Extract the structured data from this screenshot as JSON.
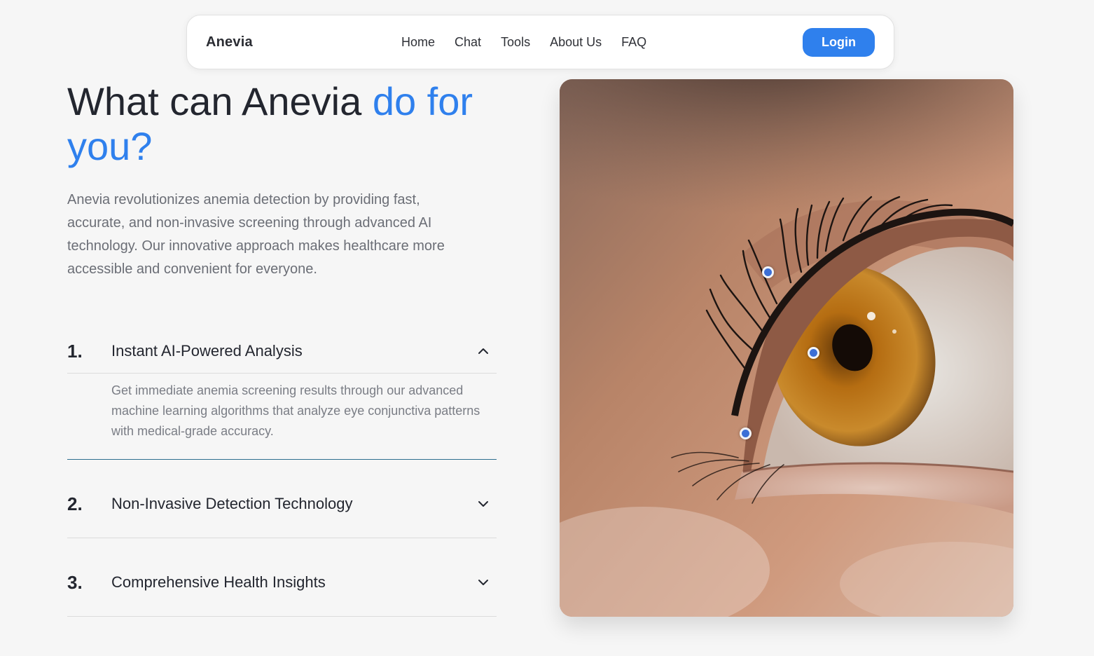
{
  "nav": {
    "brand": "Anevia",
    "links": [
      "Home",
      "Chat",
      "Tools",
      "About Us",
      "FAQ"
    ],
    "login_label": "Login"
  },
  "hero": {
    "headline_plain": "What can Anevia ",
    "headline_accent": "do for you?",
    "intro": "Anevia revolutionizes anemia detection by providing fast, accurate, and non-invasive screening through advanced AI technology. Our innovative approach makes healthcare more accessible and convenient for everyone."
  },
  "features": [
    {
      "number": "1.",
      "title": "Instant AI-Powered Analysis",
      "expanded": true,
      "body": "Get immediate anemia screening results through our advanced machine learning algorithms that analyze eye conjunctiva patterns with medical-grade accuracy."
    },
    {
      "number": "2.",
      "title": "Non-Invasive Detection Technology",
      "expanded": false
    },
    {
      "number": "3.",
      "title": "Comprehensive Health Insights",
      "expanded": false
    }
  ],
  "colors": {
    "accent": "#2f80ed",
    "background": "#f6f6f6",
    "text": "#23262f",
    "muted": "#6b6e76"
  },
  "icons": {
    "expanded": "chevron-up-icon",
    "collapsed": "chevron-down-icon"
  }
}
